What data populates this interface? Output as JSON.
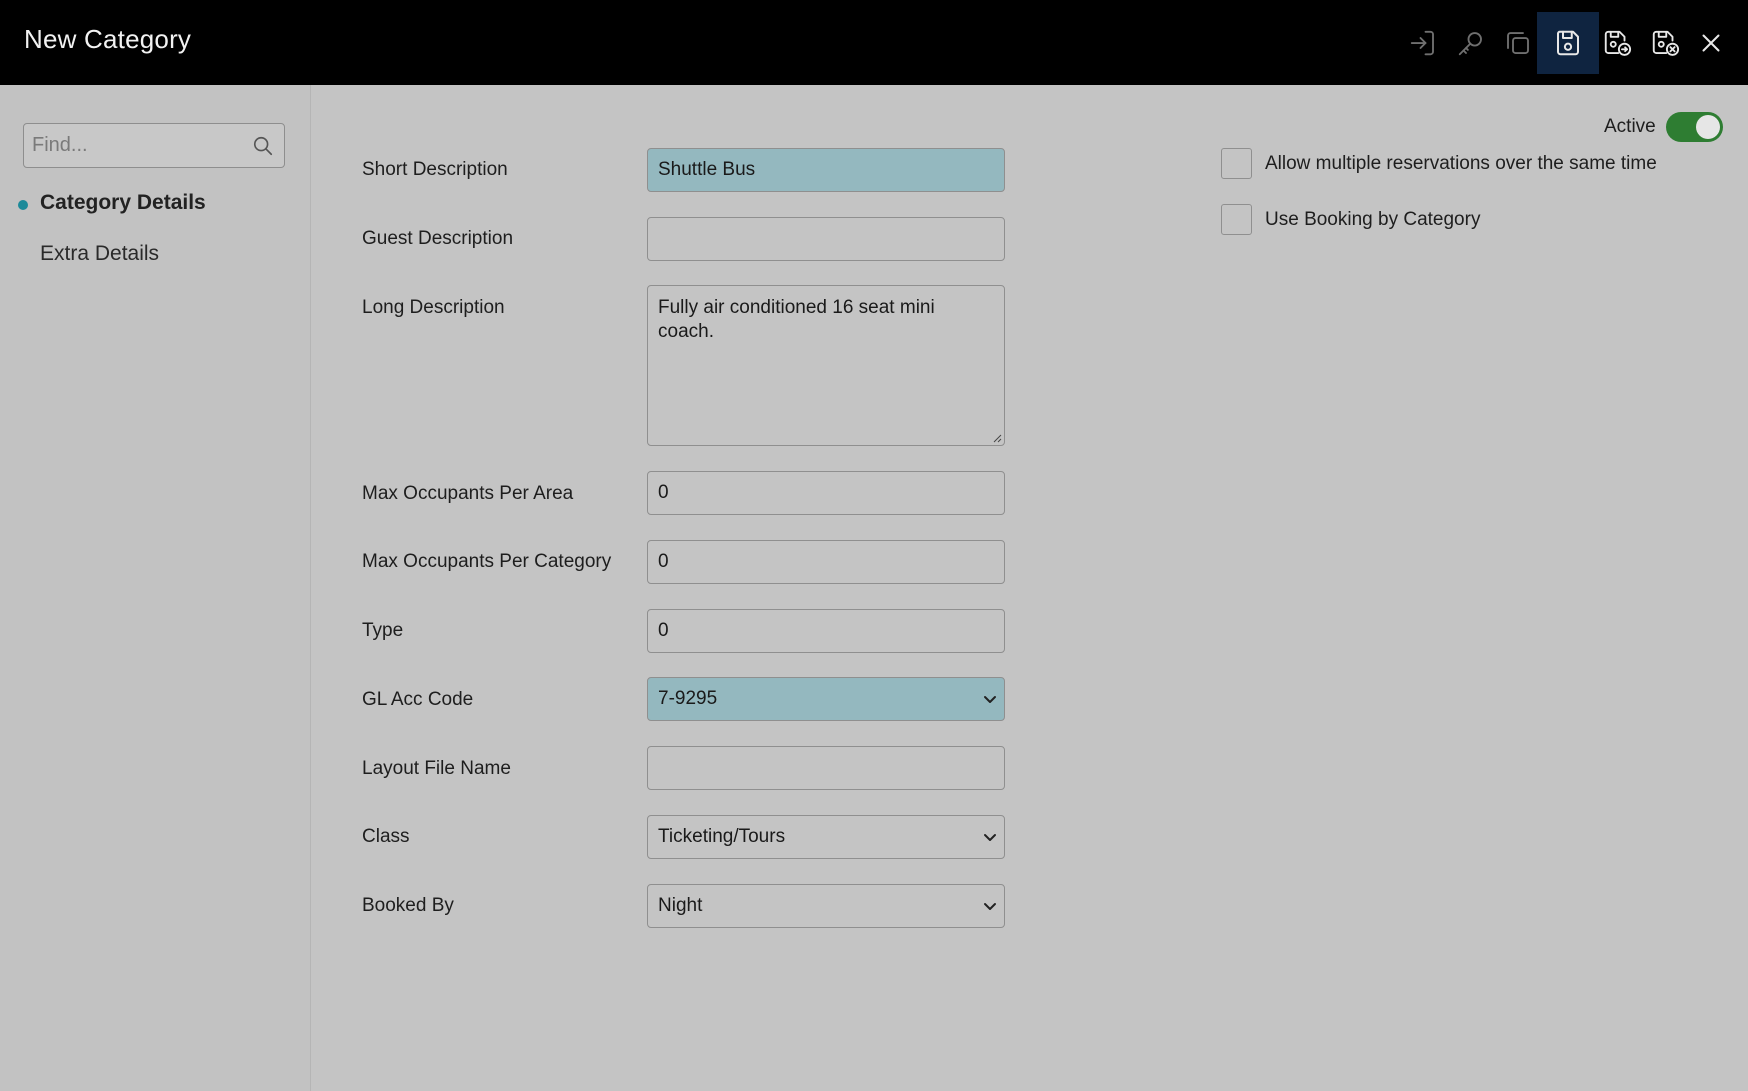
{
  "header": {
    "title": "New Category",
    "tools": [
      {
        "name": "import-icon"
      },
      {
        "name": "key-icon"
      },
      {
        "name": "copy-icon"
      },
      {
        "name": "save-icon"
      },
      {
        "name": "save-and-forward-icon"
      },
      {
        "name": "save-and-close-icon"
      },
      {
        "name": "close-icon"
      }
    ]
  },
  "sidebar": {
    "search_placeholder": "Find...",
    "items": [
      {
        "label": "Category Details",
        "active": true
      },
      {
        "label": "Extra Details",
        "active": false
      }
    ]
  },
  "form": {
    "short_description": {
      "label": "Short Description",
      "value": "Shuttle Bus"
    },
    "guest_description": {
      "label": "Guest Description",
      "value": ""
    },
    "long_description": {
      "label": "Long Description",
      "value": "Fully air conditioned 16 seat mini coach."
    },
    "max_occupants_area": {
      "label": "Max Occupants Per Area",
      "value": "0"
    },
    "max_occupants_category": {
      "label": "Max Occupants Per Category",
      "value": "0"
    },
    "type": {
      "label": "Type",
      "value": "0"
    },
    "gl_acc_code": {
      "label": "GL Acc Code",
      "value": "7-9295"
    },
    "layout_file_name": {
      "label": "Layout File Name",
      "value": ""
    },
    "class": {
      "label": "Class",
      "value": "Ticketing/Tours"
    },
    "booked_by": {
      "label": "Booked By",
      "value": "Night"
    }
  },
  "options": {
    "active_label": "Active",
    "active": true,
    "allow_multiple_label": "Allow multiple reservations over the same time",
    "use_booking_label": "Use Booking by Category"
  },
  "colors": {
    "header_bg": "#000000",
    "highlight_field": "#94b8bf",
    "toggle_on": "#2e7d32",
    "active_tool_bg": "#0f2440",
    "nav_dot": "#1c8a99"
  }
}
